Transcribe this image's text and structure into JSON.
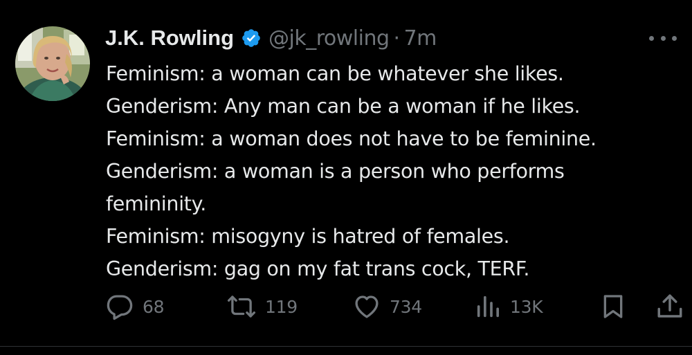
{
  "author": {
    "name": "J.K. Rowling",
    "handle": "@jk_rowling",
    "separator": "·",
    "time": "7m",
    "verified": true
  },
  "tweet": {
    "lines": [
      "Feminism: a woman can be whatever she likes.",
      "Genderism: Any man can be a woman if he likes.",
      "Feminism: a woman does not have to be feminine.",
      "Genderism: a woman is a person who performs",
      "femininity.",
      "Feminism: misogyny is hatred of females.",
      "Genderism: gag on my fat trans cock, TERF."
    ]
  },
  "actions": {
    "replies": "68",
    "reposts": "119",
    "likes": "734",
    "views": "13K"
  },
  "icons": {
    "reply": "reply-icon",
    "repost": "repost-icon",
    "like": "heart-icon",
    "views": "views-icon",
    "bookmark": "bookmark-icon",
    "share": "share-icon",
    "more": "more-icon",
    "verified": "verified-badge-icon"
  },
  "colors": {
    "background": "#000000",
    "text": "#e7e9ea",
    "muted": "#71767b",
    "verified": "#1d9bf0"
  }
}
